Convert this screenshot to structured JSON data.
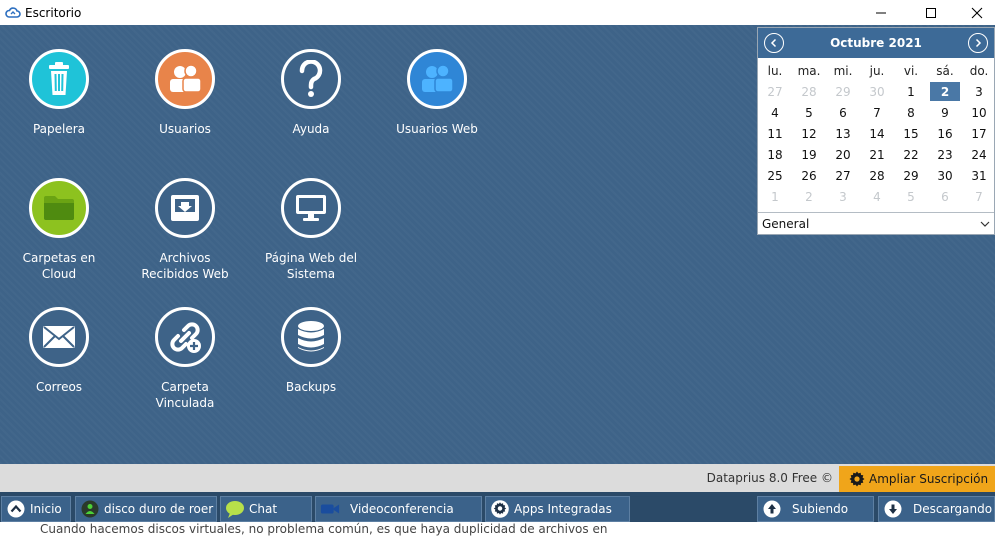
{
  "window": {
    "title": "Escritorio"
  },
  "desktop": {
    "icons": [
      {
        "label": "Papelera",
        "icon": "trash-icon"
      },
      {
        "label": "Usuarios",
        "icon": "users-icon"
      },
      {
        "label": "Ayuda",
        "icon": "help-icon"
      },
      {
        "label": "Usuarios Web",
        "icon": "web-users-icon"
      },
      {
        "label": "Carpetas en Cloud",
        "icon": "folder-icon"
      },
      {
        "label": "Archivos Recibidos Web",
        "icon": "inbox-icon"
      },
      {
        "label": "Página Web del Sistema",
        "icon": "monitor-icon"
      },
      {
        "label": "Correos",
        "icon": "mail-icon"
      },
      {
        "label": "Carpeta Vinculada",
        "icon": "link-icon"
      },
      {
        "label": "Backups",
        "icon": "database-icon"
      }
    ]
  },
  "calendar": {
    "month_label": "Octubre 2021",
    "weekdays": [
      "lu.",
      "ma.",
      "mi.",
      "ju.",
      "vi.",
      "sá.",
      "do."
    ],
    "weeks": [
      [
        "27",
        "28",
        "29",
        "30",
        "1",
        "2",
        "3"
      ],
      [
        "4",
        "5",
        "6",
        "7",
        "8",
        "9",
        "10"
      ],
      [
        "11",
        "12",
        "13",
        "14",
        "15",
        "16",
        "17"
      ],
      [
        "18",
        "19",
        "20",
        "21",
        "22",
        "23",
        "24"
      ],
      [
        "25",
        "26",
        "27",
        "28",
        "29",
        "30",
        "31"
      ],
      [
        "1",
        "2",
        "3",
        "4",
        "5",
        "6",
        "7"
      ]
    ],
    "selected_day": "2",
    "filter_value": "General"
  },
  "statusbar": {
    "version": "Dataprius 8.0 Free ©",
    "upgrade_label": "Ampliar Suscripción"
  },
  "taskbar": {
    "start_label": "Inicio",
    "disk_label": "disco duro de roer",
    "chat_label": "Chat",
    "video_label": "Videoconferencia",
    "apps_label": "Apps Integradas",
    "upload_label": "Subiendo",
    "download_label": "Descargando"
  },
  "background_doc_text": "Cuando hacemos discos virtuales, no problema común, es que haya duplicidad de archivos en",
  "colors": {
    "desktop_bg": "#3e6388",
    "trash": "#1fc3d8",
    "users": "#e8844a",
    "help": "#3e6388",
    "web_users": "#2f86d6",
    "folder": "#8dc21f",
    "upgrade": "#f0a51a",
    "calendar_header": "#3d6a97"
  }
}
